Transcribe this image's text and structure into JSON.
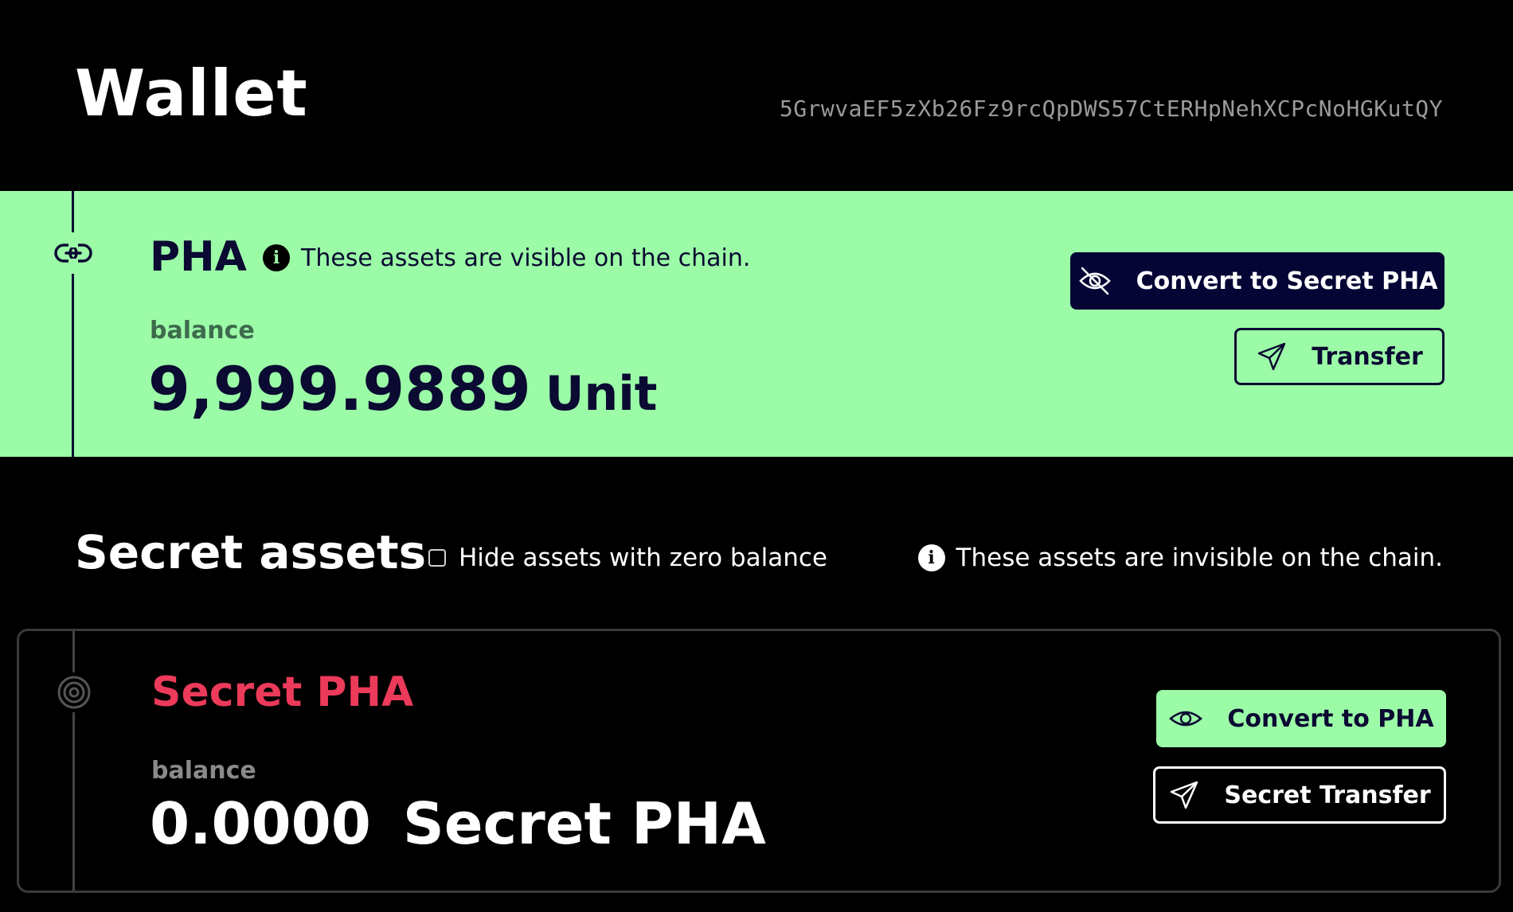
{
  "header": {
    "title": "Wallet",
    "address": "5GrwvaEF5zXb26Fz9rcQpDWS57CtERHpNehXCPcNoHGKutQY"
  },
  "pha": {
    "title": "PHA",
    "note": "These assets are visible on the chain.",
    "balance_label": "balance",
    "amount": "9,999.9889",
    "unit": "Unit",
    "convert_label": "Convert to Secret PHA",
    "transfer_label": "Transfer",
    "icon": "link-icon"
  },
  "secret_section": {
    "title": "Secret assets",
    "hide_zero_label": "Hide assets with zero balance",
    "hide_zero_checked": false,
    "note": "These assets are invisible on the chain."
  },
  "secret_pha": {
    "title": "Secret PHA",
    "balance_label": "balance",
    "amount": "0.0000",
    "unit": "Secret PHA",
    "convert_label": "Convert to PHA",
    "transfer_label": "Secret Transfer",
    "icon": "target-icon"
  },
  "colors": {
    "background": "#000000",
    "public_panel": "#9cfba7",
    "navy": "#050535",
    "secret_title": "#ec3a5a",
    "address_grey": "#9a9a9a"
  }
}
